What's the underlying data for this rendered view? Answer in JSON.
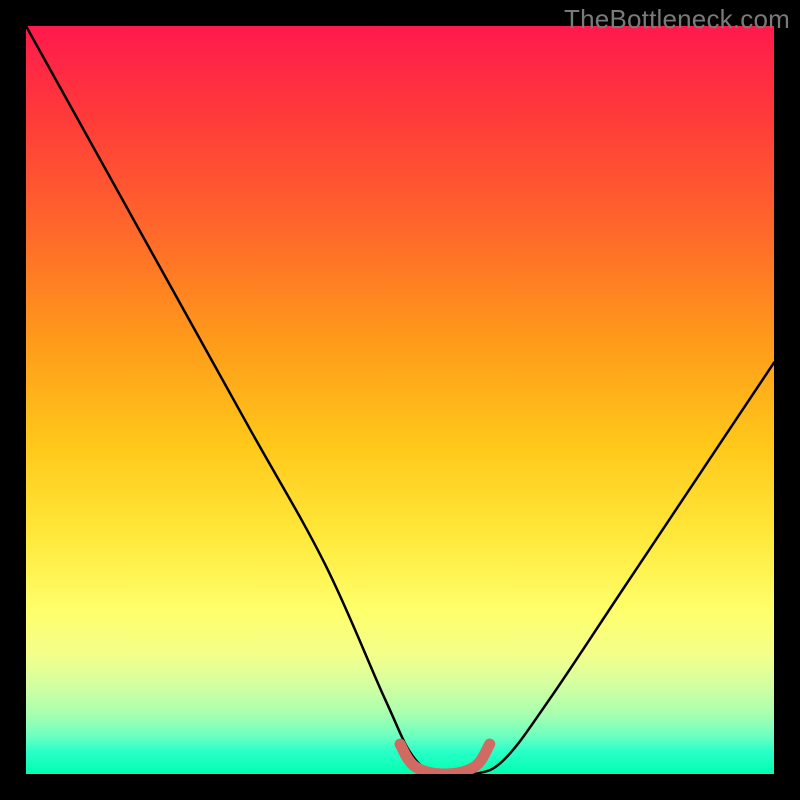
{
  "watermark": "TheBottleneck.com",
  "chart_data": {
    "type": "line",
    "title": "",
    "xlabel": "",
    "ylabel": "",
    "xlim": [
      0,
      100
    ],
    "ylim": [
      0,
      100
    ],
    "series": [
      {
        "name": "bottleneck-curve",
        "x": [
          0,
          10,
          20,
          30,
          40,
          48,
          52,
          56,
          60,
          64,
          70,
          80,
          90,
          100
        ],
        "values": [
          100,
          82,
          64,
          46,
          28,
          10,
          2,
          0,
          0,
          2,
          10,
          25,
          40,
          55
        ]
      },
      {
        "name": "optimal-range-marker",
        "x": [
          50,
          52,
          56,
          60,
          62
        ],
        "values": [
          4,
          1,
          0,
          1,
          4
        ]
      }
    ],
    "gradient_stops": [
      {
        "pos": 0,
        "color": "#ff1a4d"
      },
      {
        "pos": 50,
        "color": "#ffc81a"
      },
      {
        "pos": 100,
        "color": "#00ffb0"
      }
    ]
  }
}
